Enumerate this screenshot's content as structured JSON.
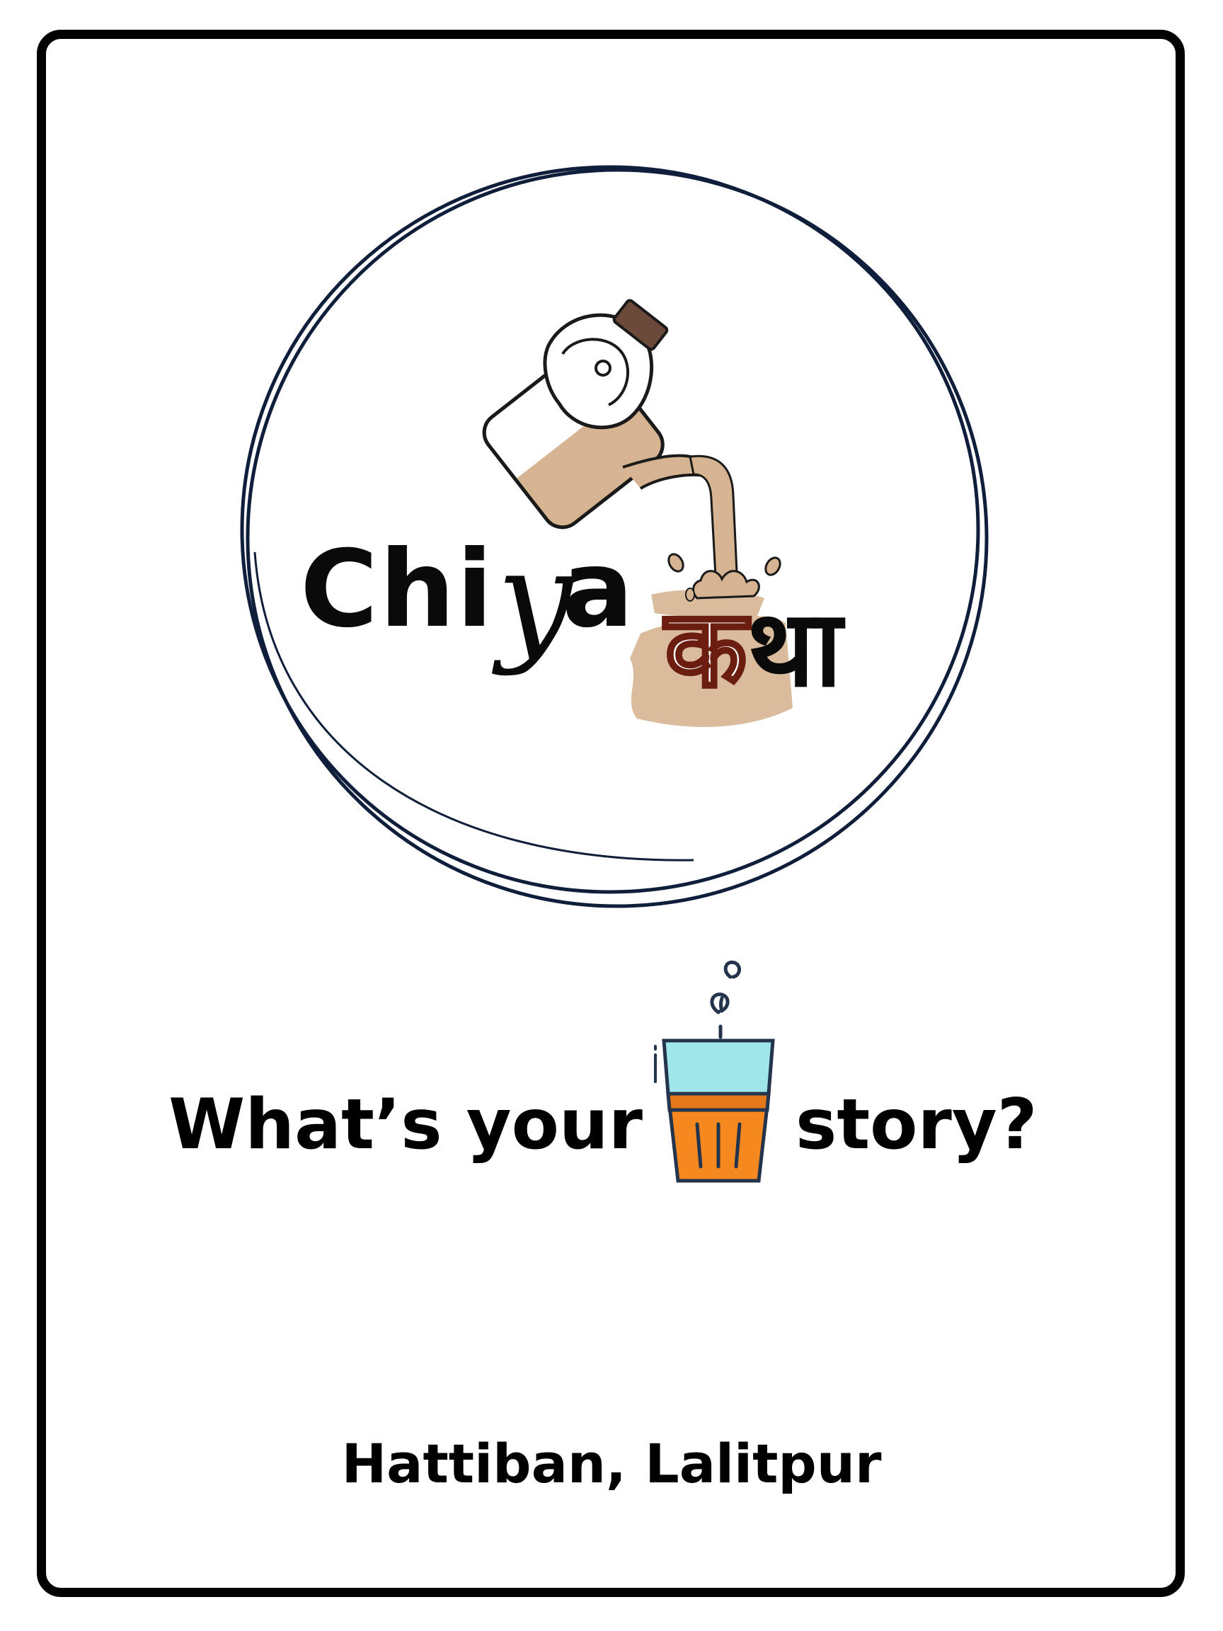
{
  "brand": {
    "part_chi": "Chi",
    "part_y": "y",
    "part_a": "a",
    "part_ka": "क",
    "part_tha": "था"
  },
  "tagline": {
    "left": "What’s your",
    "right": "story?"
  },
  "location": "Hattiban, Lalitpur",
  "icons": {
    "logo_ring": "double-circle-ring",
    "kettle": "tea-kettle-icon",
    "tea_cup": "tea-glass-icon",
    "steam": "steam-icon"
  },
  "colors": {
    "frame": "#000000",
    "ring": "#0f1e3a",
    "tea": "#d6b491",
    "kettle_lid_handle": "#6b4a3a",
    "ka_outline": "#6b1e10",
    "cup_top": "#9fe6e8",
    "cup_bottom": "#f5891f",
    "cup_outline": "#24344d"
  }
}
